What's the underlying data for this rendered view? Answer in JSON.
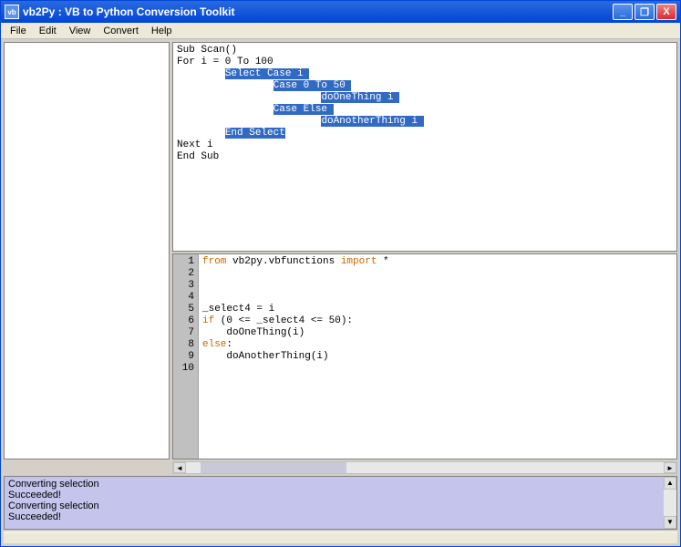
{
  "window": {
    "title": "vb2Py : VB to Python Conversion Toolkit",
    "min_label": "_",
    "max_label": "❐",
    "close_label": "X"
  },
  "menu": {
    "file": "File",
    "edit": "Edit",
    "view": "View",
    "convert": "Convert",
    "help": "Help"
  },
  "vb_code": {
    "l1": "Sub Scan()",
    "l2": "For i = 0 To 100",
    "l3_pre": "        ",
    "l3_sel": "Select Case i",
    "l4_pre": "                ",
    "l4_sel": "Case 0 To 50",
    "l5_pre": "                        ",
    "l5_sel": "doOneThing i",
    "l6_pre": "                ",
    "l6_sel": "Case Else",
    "l7_pre": "                        ",
    "l7_sel": "doAnotherThing i",
    "l8_pre": "        ",
    "l8_sel": "End Select",
    "l9": "Next i",
    "l10": "End Sub"
  },
  "py_code": {
    "lines": [
      "1",
      "2",
      "3",
      "4",
      "5",
      "6",
      "7",
      "8",
      "9",
      "10"
    ],
    "l1_kw1": "from",
    "l1_mid": " vb2py.vbfunctions ",
    "l1_kw2": "import",
    "l1_end": " *",
    "l5": "_select4 = i",
    "l6_kw": "if",
    "l6_rest": " (0 <= _select4 <= 50):",
    "l7": "    doOneThing(i)",
    "l8_kw": "else",
    "l8_rest": ":",
    "l9": "    doAnotherThing(i)"
  },
  "log": {
    "l1": "Converting selection",
    "l2": "Succeeded!",
    "l3": "Converting selection",
    "l4": "Succeeded!"
  }
}
